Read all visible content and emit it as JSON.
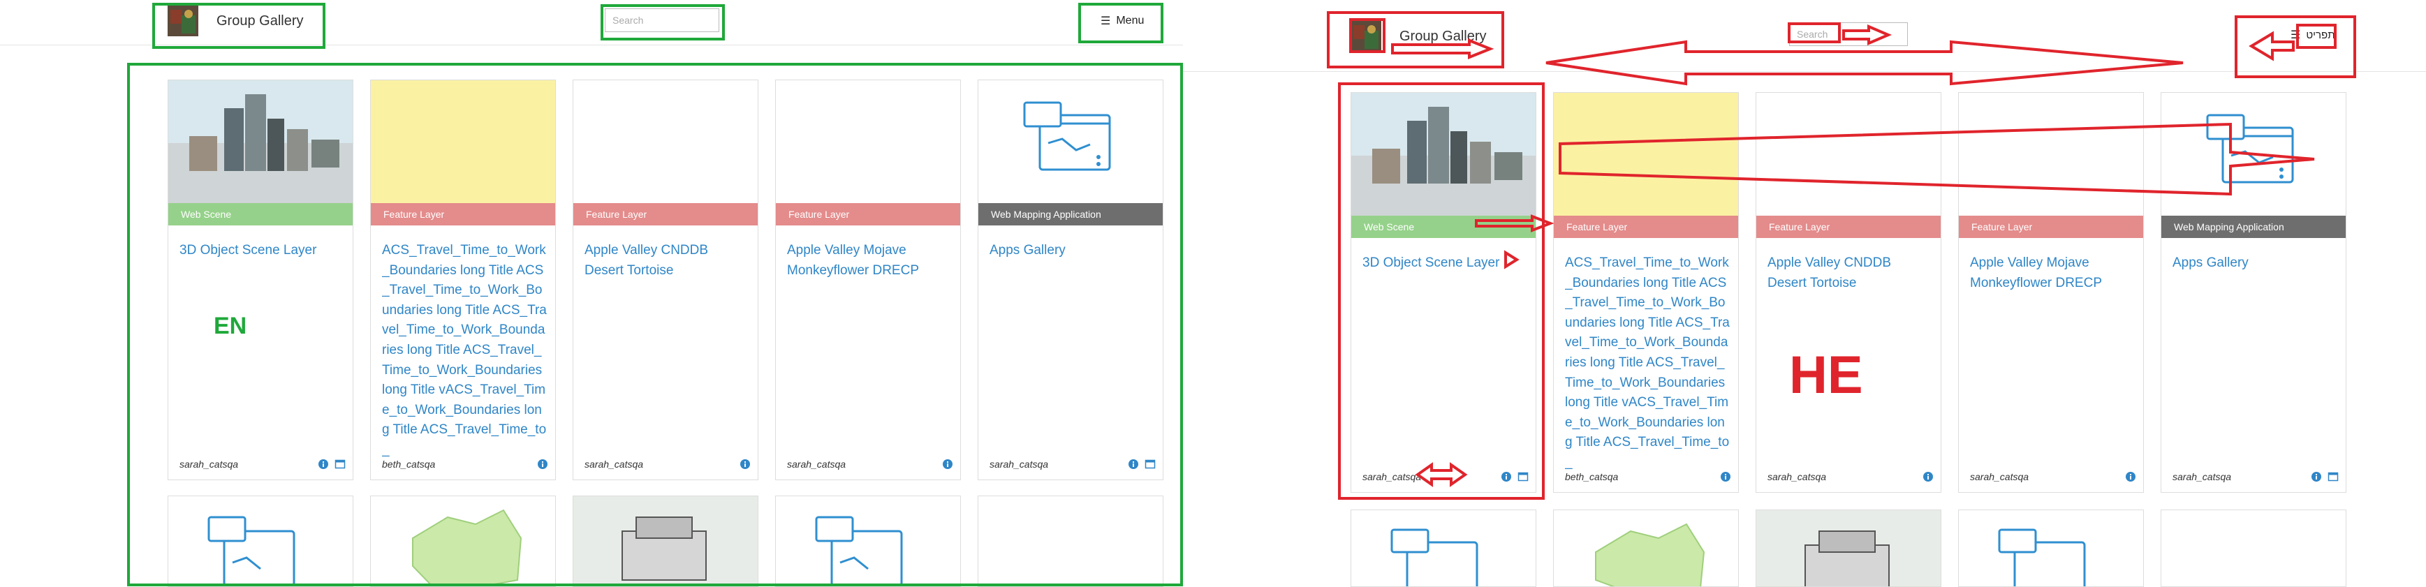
{
  "header": {
    "title": "Group Gallery",
    "search_placeholder": "Search",
    "menu_label_en": "Menu",
    "menu_label_he": "תפריט"
  },
  "cards": [
    {
      "type": "Web Scene",
      "type_color": "#95d18a",
      "title": "3D Object Scene Layer",
      "owner": "sarah_catsqa",
      "thumb": "city-scene-thumbnail"
    },
    {
      "type": "Feature Layer",
      "type_color": "#e48b8b",
      "title": "ACS_Travel_Time_to_Work_Boundaries long Title ACS_Travel_Time_to_Work_Boundaries long Title ACS_Travel_Time_to_Work_Boundaries long Title ACS_Travel_Time_to_Work_Boundaries long Title vACS_Travel_Time_to_Work_Boundaries long Title ACS_Travel_Time_to_",
      "owner": "beth_catsqa",
      "thumb": "yellow-thumbnail"
    },
    {
      "type": "Feature Layer",
      "type_color": "#e48b8b",
      "title": "Apple Valley CNDDB Desert Tortoise",
      "owner": "sarah_catsqa",
      "thumb": "blank-thumbnail"
    },
    {
      "type": "Feature Layer",
      "type_color": "#e48b8b",
      "title": "Apple Valley Mojave Monkeyflower DRECP",
      "owner": "sarah_catsqa",
      "thumb": "blank-thumbnail"
    },
    {
      "type": "Web Mapping Application",
      "type_color": "#6e6e6e",
      "title": "Apps Gallery",
      "owner": "sarah_catsqa",
      "thumb": "web-app-thumbnail"
    }
  ],
  "labels": {
    "en": "EN",
    "he": "HE"
  },
  "colors": {
    "link": "#2f86c7",
    "en_annotation": "#1fa83a",
    "he_annotation": "#e0242c"
  }
}
